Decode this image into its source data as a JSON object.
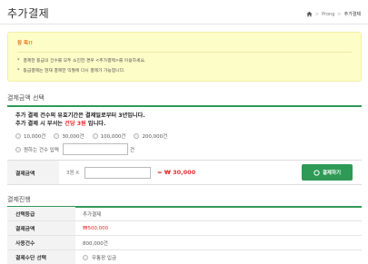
{
  "header": {
    "title": "추가결제",
    "breadcrumb": {
      "home_icon": "home-icon",
      "separator1": ">",
      "item1": "Prong",
      "separator2": ">",
      "current": "추가결제"
    }
  },
  "notice": {
    "title": "참 목!!",
    "bullet": "*",
    "items": [
      "결제한 등급의 건수를 모두 소진한 경우 <추가결제>를 이용하세요.",
      "등급결제는 현재 결제한 익월에 다시 결제가 가능합니다."
    ]
  },
  "section1": {
    "title": "결제금액 선택",
    "line1": "추가 결제 건수의 유효기간은 결제일로부터 3년입니다.",
    "line2_prefix": "추가 결제 시 부서는",
    "line2_highlight": "건당 3원",
    "line2_suffix": "입니다.",
    "options": [
      "10,000건",
      "30,000건",
      "100,000건",
      "200,000건"
    ],
    "custom_option": "원하는 건수 입력",
    "custom_suffix": "건",
    "pay_row": {
      "label": "결제금액",
      "unit": "3원 X",
      "total": "= ₩ 30,000",
      "button": "결제하기",
      "button_icon": "check-circle-icon"
    }
  },
  "section2": {
    "title": "결제진행",
    "rows": [
      {
        "label": "선택등급",
        "value": "추가결제"
      },
      {
        "label": "결제금액",
        "value": "₩500,000"
      },
      {
        "label": "사용건수",
        "value": "800,000건"
      },
      {
        "label": "결제수단 선택",
        "value": "무통장 입금"
      }
    ]
  },
  "colors": {
    "accent_green": "#2e9a56",
    "highlight_red": "#e52f2f",
    "notice_bg": "#fdfdc8",
    "notice_title": "#e8741d"
  }
}
